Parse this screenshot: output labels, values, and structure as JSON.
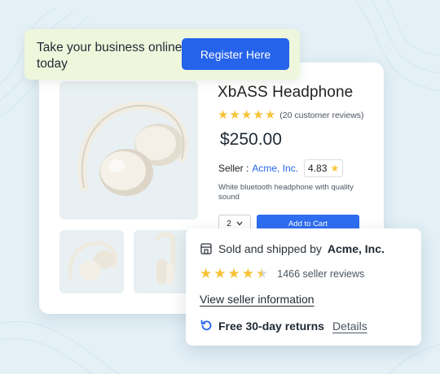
{
  "promo": {
    "text": "Take your business online today",
    "button_label": "Register Here"
  },
  "product": {
    "title": "XbASS Headphone",
    "rating_stars": 5,
    "reviews_text": "(20 customer reviews)",
    "price": "$250.00",
    "seller_label": "Seller :",
    "seller_name": "Acme, Inc.",
    "seller_score": "4.83",
    "description": "White bluetooth headphone with quality sound",
    "quantity": "2",
    "add_to_cart_label": "Add to Cart"
  },
  "seller_card": {
    "sold_prefix": "Sold and shipped by",
    "sold_by": "Acme, Inc.",
    "rating_stars": 4.5,
    "seller_reviews": "1466 seller reviews",
    "view_info_label": "View seller information",
    "returns_text": "Free 30-day returns",
    "details_label": "Details"
  },
  "colors": {
    "background": "#e3f0f6",
    "accent_blue": "#2563eb",
    "star": "#f7c236",
    "promo_bg": "#eef7dc"
  },
  "icons": [
    "store-icon",
    "star-icon",
    "refresh-icon",
    "chevron-down-icon",
    "headphone-image"
  ]
}
